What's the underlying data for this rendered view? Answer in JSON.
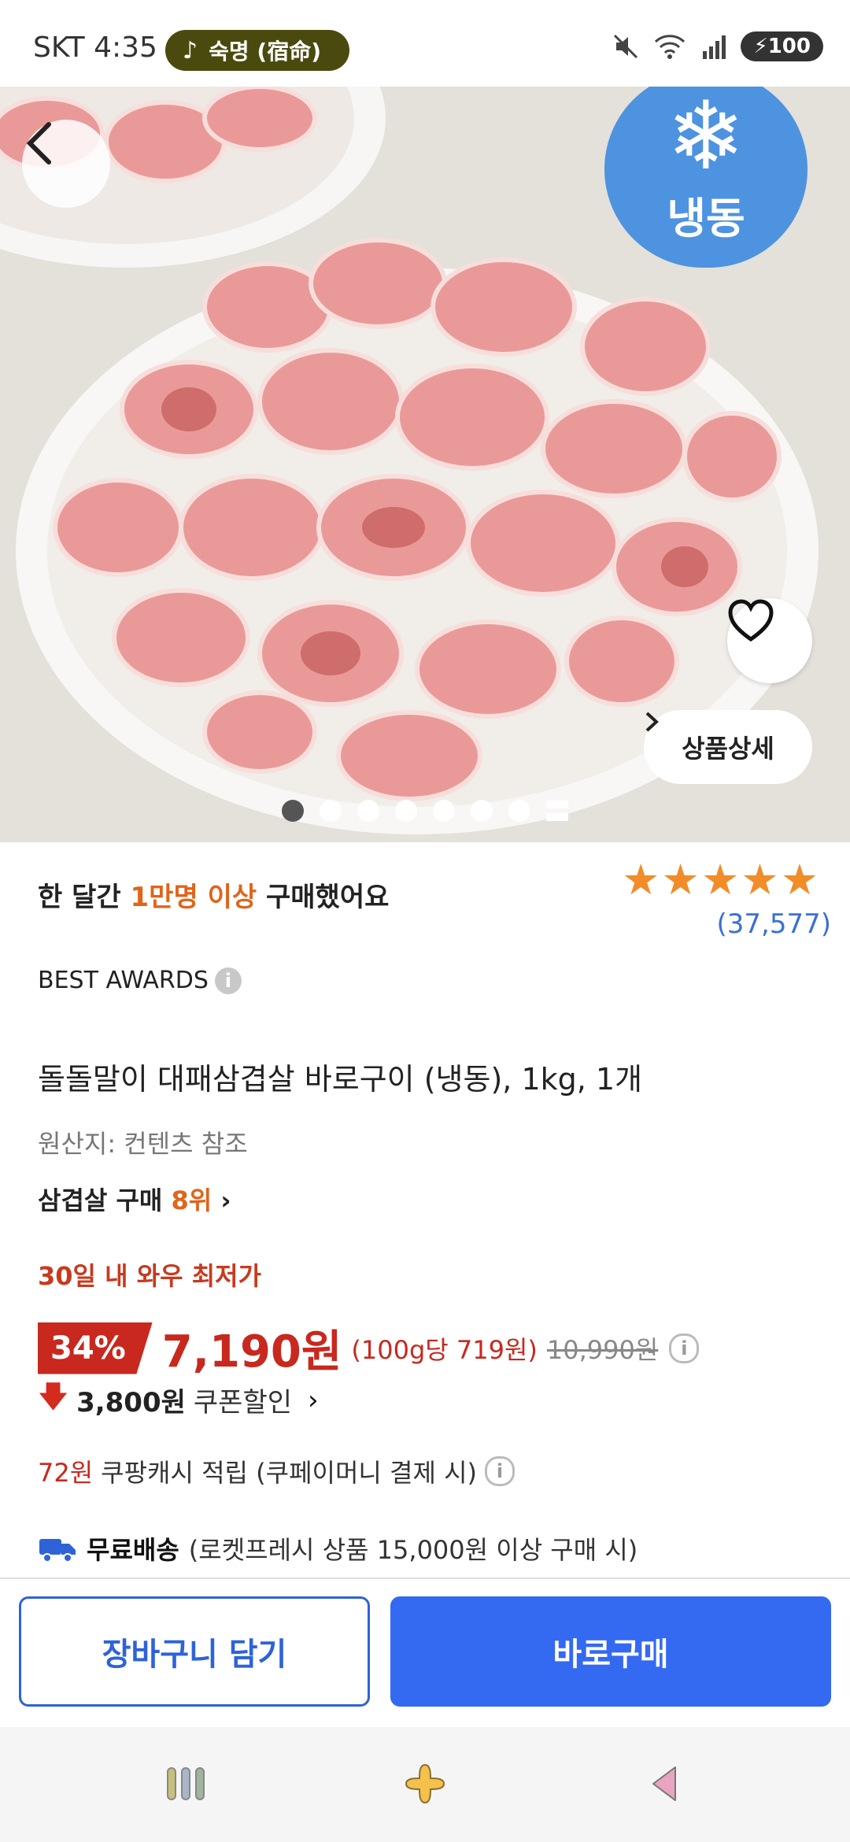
{
  "status_bar": {
    "carrier": "SKT",
    "time": "4:35",
    "music": "숙명 (宿命)",
    "battery": "100"
  },
  "hero": {
    "frozen_label": "냉동",
    "detail_label": "상품상세"
  },
  "product": {
    "monthly_prefix": "한 달간 ",
    "monthly_highlight": "1만명 이상",
    "monthly_suffix": " 구매했어요",
    "rating_stars": 5,
    "review_count": "(37,577)",
    "awards": "BEST AWARDS",
    "title": "돌돌말이 대패삼겹살 바로구이 (냉동), 1kg, 1개",
    "origin": "원산지: 컨텐츠 참조",
    "rank_prefix": "삼겹살 구매 ",
    "rank_num": "8위",
    "wow_label": "30일 내 와우 최저가",
    "discount": "34%",
    "price": "7,190원",
    "unit_price": "(100g당 719원)",
    "original_price": "10,990원",
    "coupon_amount": "3,800원",
    "coupon_label": "쿠폰할인",
    "cash_amount": "72원",
    "cash_label": "쿠팡캐시 적립 (쿠페이머니 결제 시)",
    "shipping_bold": "무료배송",
    "shipping_note": "(로켓프레시 상품 15,000원 이상 구매 시)"
  },
  "actions": {
    "cart": "장바구니 담기",
    "buy": "바로구매"
  },
  "colors": {
    "accent_blue": "#3469f2",
    "price_red": "#c8281e",
    "highlight_orange": "#e0641a"
  }
}
